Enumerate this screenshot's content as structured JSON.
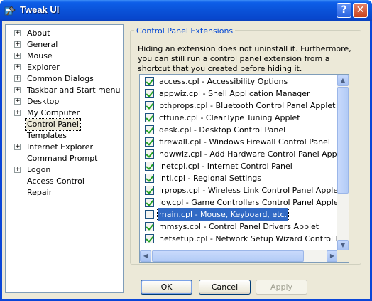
{
  "window": {
    "title": "Tweak UI",
    "help_label": "?",
    "close_label": "✕"
  },
  "tree": {
    "items": [
      {
        "label": "About",
        "expandable": true
      },
      {
        "label": "General",
        "expandable": true
      },
      {
        "label": "Mouse",
        "expandable": true
      },
      {
        "label": "Explorer",
        "expandable": true
      },
      {
        "label": "Common Dialogs",
        "expandable": true
      },
      {
        "label": "Taskbar and Start menu",
        "expandable": true
      },
      {
        "label": "Desktop",
        "expandable": true
      },
      {
        "label": "My Computer",
        "expandable": true
      },
      {
        "label": "Control Panel",
        "expandable": false,
        "selected": true
      },
      {
        "label": "Templates",
        "expandable": false
      },
      {
        "label": "Internet Explorer",
        "expandable": true
      },
      {
        "label": "Command Prompt",
        "expandable": false
      },
      {
        "label": "Logon",
        "expandable": true
      },
      {
        "label": "Access Control",
        "expandable": false
      },
      {
        "label": "Repair",
        "expandable": false
      }
    ]
  },
  "panel": {
    "group_title": "Control Panel Extensions",
    "description": "Hiding an extension does not uninstall it. Furthermore, you can still run a control panel extension from a shortcut that you created before hiding it."
  },
  "extensions": [
    {
      "label": "access.cpl - Accessibility Options",
      "checked": true
    },
    {
      "label": "appwiz.cpl - Shell Application Manager",
      "checked": true
    },
    {
      "label": "bthprops.cpl - Bluetooth Control Panel Applet",
      "checked": true
    },
    {
      "label": "cttune.cpl - ClearType Tuning Applet",
      "checked": true
    },
    {
      "label": "desk.cpl - Desktop Control Panel",
      "checked": true
    },
    {
      "label": "firewall.cpl - Windows Firewall Control Panel",
      "checked": true
    },
    {
      "label": "hdwwiz.cpl - Add Hardware Control Panel Applet",
      "checked": true
    },
    {
      "label": "inetcpl.cpl - Internet Control Panel",
      "checked": true
    },
    {
      "label": "intl.cpl - Regional Settings",
      "checked": true
    },
    {
      "label": "irprops.cpl - Wireless Link Control Panel Applet",
      "checked": true
    },
    {
      "label": "joy.cpl - Game Controllers Control Panel Applet",
      "checked": true
    },
    {
      "label": "main.cpl - Mouse, Keyboard, etc.",
      "checked": false,
      "selected": true
    },
    {
      "label": "mmsys.cpl - Control Panel Drivers Applet",
      "checked": true
    },
    {
      "label": "netsetup.cpl - Network Setup Wizard Control Panel A",
      "checked": true
    }
  ],
  "buttons": {
    "ok": "OK",
    "cancel": "Cancel",
    "apply": "Apply"
  },
  "scroll": {
    "up": "▲",
    "down": "▼",
    "left": "◀",
    "right": "▶"
  },
  "colors": {
    "titlebar": "#0a52d8",
    "selection": "#316ac5",
    "group_title": "#0046d5"
  }
}
